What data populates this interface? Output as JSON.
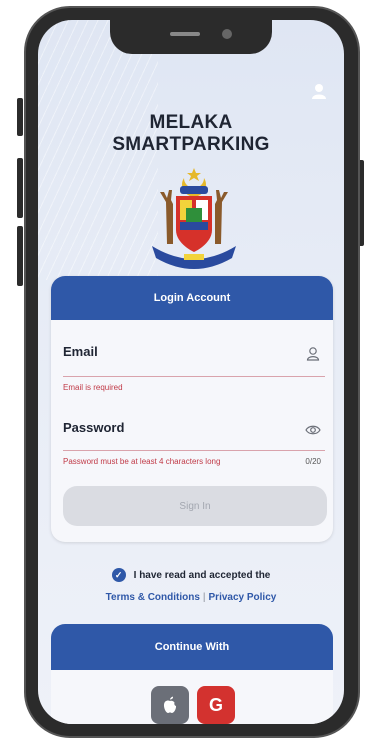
{
  "app": {
    "title_line1": "MELAKA",
    "title_line2": "SMARTPARKING"
  },
  "login": {
    "header": "Login Account",
    "email": {
      "label": "Email",
      "value": "",
      "error": "Email is required",
      "icon": "person-icon"
    },
    "password": {
      "label": "Password",
      "value": "",
      "error": "Password must be at least 4 characters long",
      "counter": "0/20",
      "icon": "eye-icon"
    },
    "signin_label": "Sign In"
  },
  "consent": {
    "checked": true,
    "text": "I have read and accepted the",
    "terms_link": "Terms & Conditions",
    "separator": "|",
    "privacy_link": "Privacy Policy"
  },
  "continue": {
    "header": "Continue With",
    "apple_icon": "apple-icon",
    "google_label": "G"
  },
  "colors": {
    "primary": "#2f58a8",
    "error": "#c03a47",
    "google": "#d3322f",
    "apple": "#6b6f78"
  }
}
